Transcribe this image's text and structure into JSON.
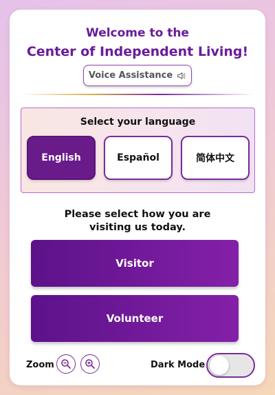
{
  "header": {
    "title_line1": "Welcome to the",
    "title_line2": "Center of Independent Living!",
    "voice_button_label": "Voice Assistance",
    "voice_icon": "speaker-icon"
  },
  "language": {
    "title": "Select your language",
    "options": [
      {
        "label": "English",
        "selected": true
      },
      {
        "label": "Español",
        "selected": false
      },
      {
        "label": "简体中文",
        "selected": false
      }
    ]
  },
  "visit": {
    "prompt_line1": "Please select how you are",
    "prompt_line2": "visiting us today.",
    "visitor_label": "Visitor",
    "volunteer_label": "Volunteer"
  },
  "footer": {
    "zoom_label": "Zoom",
    "zoom_out_icon": "zoom-out-icon",
    "zoom_in_icon": "zoom-in-icon",
    "dark_mode_label": "Dark Mode",
    "dark_mode_on": false
  },
  "colors": {
    "accent": "#6a1b9a",
    "button_gradient_start": "#5c128a",
    "button_gradient_end": "#8420a8"
  }
}
